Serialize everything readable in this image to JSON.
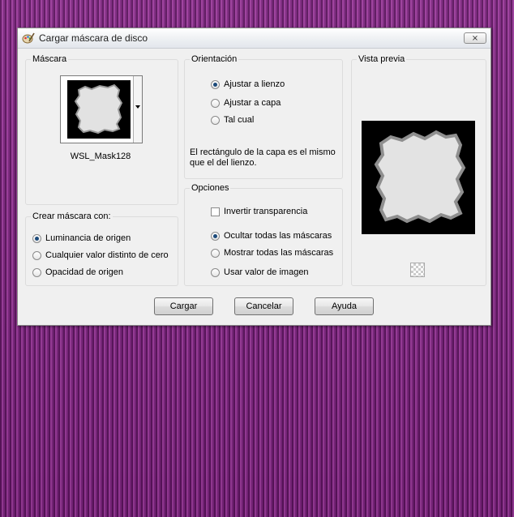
{
  "dialog": {
    "title": "Cargar máscara de disco",
    "close_label": "⨯"
  },
  "mask_group": {
    "title": "Máscara",
    "mask_name": "WSL_Mask128"
  },
  "orientation": {
    "title": "Orientación",
    "options": [
      {
        "label": "Ajustar a lienzo",
        "checked": true
      },
      {
        "label": "Ajustar a capa",
        "checked": false
      },
      {
        "label": "Tal cual",
        "checked": false
      }
    ],
    "description": "El rectángulo de la capa es el mismo que el del lienzo."
  },
  "preview": {
    "title": "Vista previa"
  },
  "create_mask": {
    "title": "Crear máscara con:",
    "options": [
      {
        "label": "Luminancia de origen",
        "checked": true
      },
      {
        "label": "Cualquier valor distinto de cero",
        "checked": false
      },
      {
        "label": "Opacidad de origen",
        "checked": false
      }
    ]
  },
  "options": {
    "title": "Opciones",
    "invert_label": "Invertir transparencia",
    "invert_checked": false,
    "radios": [
      {
        "label": "Ocultar todas las máscaras",
        "checked": true
      },
      {
        "label": "Mostrar todas las máscaras",
        "checked": false
      },
      {
        "label": "Usar valor de imagen",
        "checked": false
      }
    ]
  },
  "buttons": {
    "load": "Cargar",
    "cancel": "Cancelar",
    "help": "Ayuda"
  },
  "colors": {
    "desktop_stripe": "#7a1f7c",
    "dialog_bg": "#f0f0f0",
    "radio_dot": "#1c4a7a"
  }
}
